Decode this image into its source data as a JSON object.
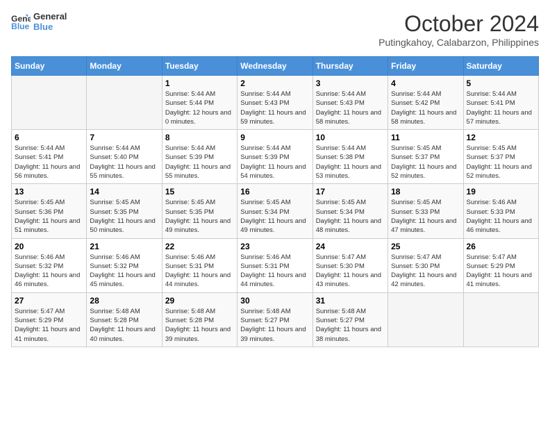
{
  "logo": {
    "line1": "General",
    "line2": "Blue"
  },
  "title": "October 2024",
  "subtitle": "Putingkahoy, Calabarzon, Philippines",
  "weekdays": [
    "Sunday",
    "Monday",
    "Tuesday",
    "Wednesday",
    "Thursday",
    "Friday",
    "Saturday"
  ],
  "weeks": [
    [
      {
        "day": null
      },
      {
        "day": null
      },
      {
        "day": "1",
        "sunrise": "5:44 AM",
        "sunset": "5:44 PM",
        "daylight": "12 hours and 0 minutes."
      },
      {
        "day": "2",
        "sunrise": "5:44 AM",
        "sunset": "5:43 PM",
        "daylight": "11 hours and 59 minutes."
      },
      {
        "day": "3",
        "sunrise": "5:44 AM",
        "sunset": "5:43 PM",
        "daylight": "11 hours and 58 minutes."
      },
      {
        "day": "4",
        "sunrise": "5:44 AM",
        "sunset": "5:42 PM",
        "daylight": "11 hours and 58 minutes."
      },
      {
        "day": "5",
        "sunrise": "5:44 AM",
        "sunset": "5:41 PM",
        "daylight": "11 hours and 57 minutes."
      }
    ],
    [
      {
        "day": "6",
        "sunrise": "5:44 AM",
        "sunset": "5:41 PM",
        "daylight": "11 hours and 56 minutes."
      },
      {
        "day": "7",
        "sunrise": "5:44 AM",
        "sunset": "5:40 PM",
        "daylight": "11 hours and 55 minutes."
      },
      {
        "day": "8",
        "sunrise": "5:44 AM",
        "sunset": "5:39 PM",
        "daylight": "11 hours and 55 minutes."
      },
      {
        "day": "9",
        "sunrise": "5:44 AM",
        "sunset": "5:39 PM",
        "daylight": "11 hours and 54 minutes."
      },
      {
        "day": "10",
        "sunrise": "5:44 AM",
        "sunset": "5:38 PM",
        "daylight": "11 hours and 53 minutes."
      },
      {
        "day": "11",
        "sunrise": "5:45 AM",
        "sunset": "5:37 PM",
        "daylight": "11 hours and 52 minutes."
      },
      {
        "day": "12",
        "sunrise": "5:45 AM",
        "sunset": "5:37 PM",
        "daylight": "11 hours and 52 minutes."
      }
    ],
    [
      {
        "day": "13",
        "sunrise": "5:45 AM",
        "sunset": "5:36 PM",
        "daylight": "11 hours and 51 minutes."
      },
      {
        "day": "14",
        "sunrise": "5:45 AM",
        "sunset": "5:35 PM",
        "daylight": "11 hours and 50 minutes."
      },
      {
        "day": "15",
        "sunrise": "5:45 AM",
        "sunset": "5:35 PM",
        "daylight": "11 hours and 49 minutes."
      },
      {
        "day": "16",
        "sunrise": "5:45 AM",
        "sunset": "5:34 PM",
        "daylight": "11 hours and 49 minutes."
      },
      {
        "day": "17",
        "sunrise": "5:45 AM",
        "sunset": "5:34 PM",
        "daylight": "11 hours and 48 minutes."
      },
      {
        "day": "18",
        "sunrise": "5:45 AM",
        "sunset": "5:33 PM",
        "daylight": "11 hours and 47 minutes."
      },
      {
        "day": "19",
        "sunrise": "5:46 AM",
        "sunset": "5:33 PM",
        "daylight": "11 hours and 46 minutes."
      }
    ],
    [
      {
        "day": "20",
        "sunrise": "5:46 AM",
        "sunset": "5:32 PM",
        "daylight": "11 hours and 46 minutes."
      },
      {
        "day": "21",
        "sunrise": "5:46 AM",
        "sunset": "5:32 PM",
        "daylight": "11 hours and 45 minutes."
      },
      {
        "day": "22",
        "sunrise": "5:46 AM",
        "sunset": "5:31 PM",
        "daylight": "11 hours and 44 minutes."
      },
      {
        "day": "23",
        "sunrise": "5:46 AM",
        "sunset": "5:31 PM",
        "daylight": "11 hours and 44 minutes."
      },
      {
        "day": "24",
        "sunrise": "5:47 AM",
        "sunset": "5:30 PM",
        "daylight": "11 hours and 43 minutes."
      },
      {
        "day": "25",
        "sunrise": "5:47 AM",
        "sunset": "5:30 PM",
        "daylight": "11 hours and 42 minutes."
      },
      {
        "day": "26",
        "sunrise": "5:47 AM",
        "sunset": "5:29 PM",
        "daylight": "11 hours and 41 minutes."
      }
    ],
    [
      {
        "day": "27",
        "sunrise": "5:47 AM",
        "sunset": "5:29 PM",
        "daylight": "11 hours and 41 minutes."
      },
      {
        "day": "28",
        "sunrise": "5:48 AM",
        "sunset": "5:28 PM",
        "daylight": "11 hours and 40 minutes."
      },
      {
        "day": "29",
        "sunrise": "5:48 AM",
        "sunset": "5:28 PM",
        "daylight": "11 hours and 39 minutes."
      },
      {
        "day": "30",
        "sunrise": "5:48 AM",
        "sunset": "5:27 PM",
        "daylight": "11 hours and 39 minutes."
      },
      {
        "day": "31",
        "sunrise": "5:48 AM",
        "sunset": "5:27 PM",
        "daylight": "11 hours and 38 minutes."
      },
      {
        "day": null
      },
      {
        "day": null
      }
    ]
  ]
}
